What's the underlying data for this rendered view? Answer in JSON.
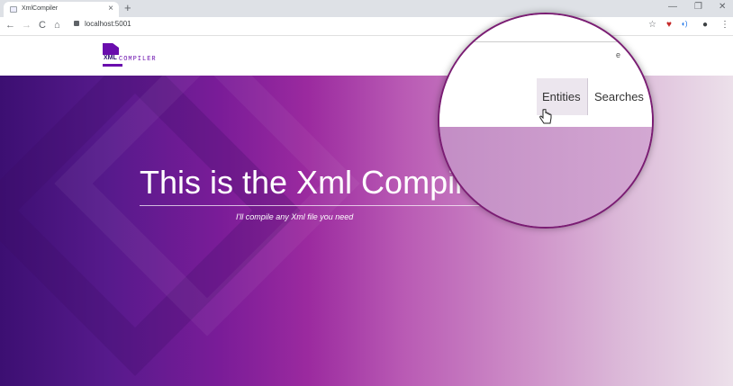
{
  "browser": {
    "tab_title": "XmlCompiler",
    "tab_close": "×",
    "new_tab": "+",
    "url": "localhost:5001",
    "nav": {
      "back": "←",
      "forward": "→",
      "reload": "C",
      "home": "⌂"
    },
    "window_controls": {
      "minimize": "—",
      "restore": "❐",
      "close": "✕"
    },
    "toolbar_icons": {
      "star": "☆",
      "ext1": "♥",
      "ext2": "◖)",
      "account": "●",
      "menu": "⋮"
    }
  },
  "site": {
    "logo_xml": "XML",
    "logo_compiler": "COMPILER",
    "nav": {
      "entities": "Entities",
      "searches": "Searches",
      "partial": "e"
    }
  },
  "hero": {
    "title": "This is the Xml Compiler",
    "subtitle": "I'll compile any Xml file you need"
  },
  "colors": {
    "brand": "#6a0dad",
    "hero_start": "#3c0f72",
    "hero_end": "#ece0ea"
  },
  "icons": [
    "favicon-icon",
    "close-icon",
    "plus-icon",
    "back-arrow-icon",
    "forward-arrow-icon",
    "reload-icon",
    "home-icon",
    "lock-icon",
    "star-icon",
    "shield-icon",
    "extension-icon",
    "account-icon",
    "menu-icon",
    "hand-cursor-icon"
  ]
}
